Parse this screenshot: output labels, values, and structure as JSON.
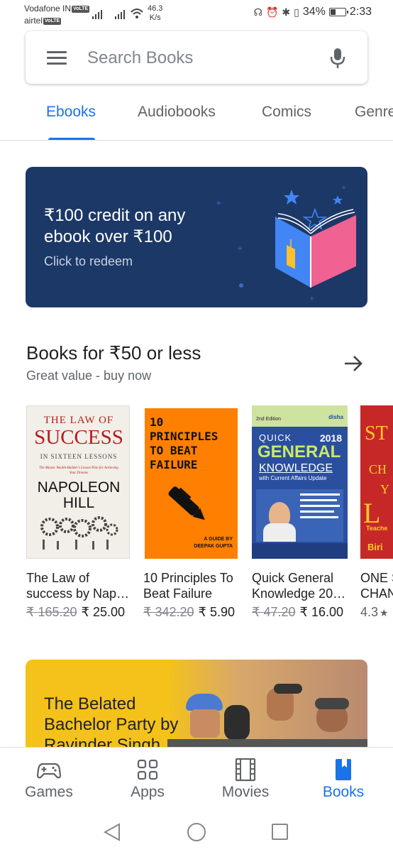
{
  "status_bar": {
    "carrier1": "Vodafone IN",
    "carrier2": "airtel",
    "volte_badge": "VoLTE",
    "speed_value": "46.3",
    "speed_unit": "K/s",
    "battery": "34%",
    "time": "2:33"
  },
  "search": {
    "placeholder": "Search Books"
  },
  "tabs": [
    {
      "label": "Ebooks",
      "active": true
    },
    {
      "label": "Audiobooks",
      "active": false
    },
    {
      "label": "Comics",
      "active": false
    },
    {
      "label": "Genres",
      "active": false
    }
  ],
  "promo": {
    "title": "₹100 credit on any ebook over ₹100",
    "subtitle": "Click to redeem",
    "background": "#1c3866"
  },
  "section": {
    "title": "Books for ₹50 or less",
    "subtitle": "Great value - buy now"
  },
  "books": [
    {
      "cover": {
        "line1": "THE LAW OF",
        "line2": "SUCCESS",
        "line3": "IN SIXTEEN LESSONS",
        "tagline": "The Master Wealth-Builder's Lesson Plan for Achieving Your Dreams",
        "author1": "NAPOLEON",
        "author2": "HILL"
      },
      "title_line1": "The Law of",
      "title_line2": "success by Nap…",
      "old_price": "₹ 165.20",
      "price": "₹ 25.00"
    },
    {
      "cover": {
        "line1": "10",
        "line2": "PRINCIPLES",
        "line3": "TO BEAT",
        "line4": "FAILURE",
        "guide1": "A GUIDE BY",
        "guide2": "DEEPAK GUPTA"
      },
      "title_line1": "10 Principles To",
      "title_line2": "Beat Failure",
      "old_price": "₹ 342.20",
      "price": "₹ 5.90"
    },
    {
      "cover": {
        "edition": "2nd Edition",
        "publisher": "disha",
        "quick": "QUICK",
        "year": "2018",
        "general": "GENERAL",
        "knowledge": "KNOWLEDGE",
        "update": "with Current Affairs Update"
      },
      "title_line1": "Quick General",
      "title_line2": "Knowledge 20…",
      "old_price": "₹ 47.20",
      "price": "₹ 16.00"
    },
    {
      "cover": {
        "line1": "ST",
        "line2": "CH",
        "line3": "Y",
        "line4": "L",
        "line5": "Teache",
        "line6": "Biri"
      },
      "title_line1": "ONE S",
      "title_line2": "CHAN",
      "rating": "4.3"
    }
  ],
  "promo2": {
    "title": "The Belated Bachelor Party by Ravinder Singh"
  },
  "bottom_nav": [
    {
      "label": "Games",
      "icon": "gamepad-icon",
      "active": false
    },
    {
      "label": "Apps",
      "icon": "apps-grid-icon",
      "active": false
    },
    {
      "label": "Movies",
      "icon": "film-icon",
      "active": false
    },
    {
      "label": "Books",
      "icon": "book-icon",
      "active": true
    }
  ],
  "colors": {
    "accent": "#1a73e8",
    "promo_blue": "#1c3866",
    "promo2_yellow": "#f4c21a"
  }
}
